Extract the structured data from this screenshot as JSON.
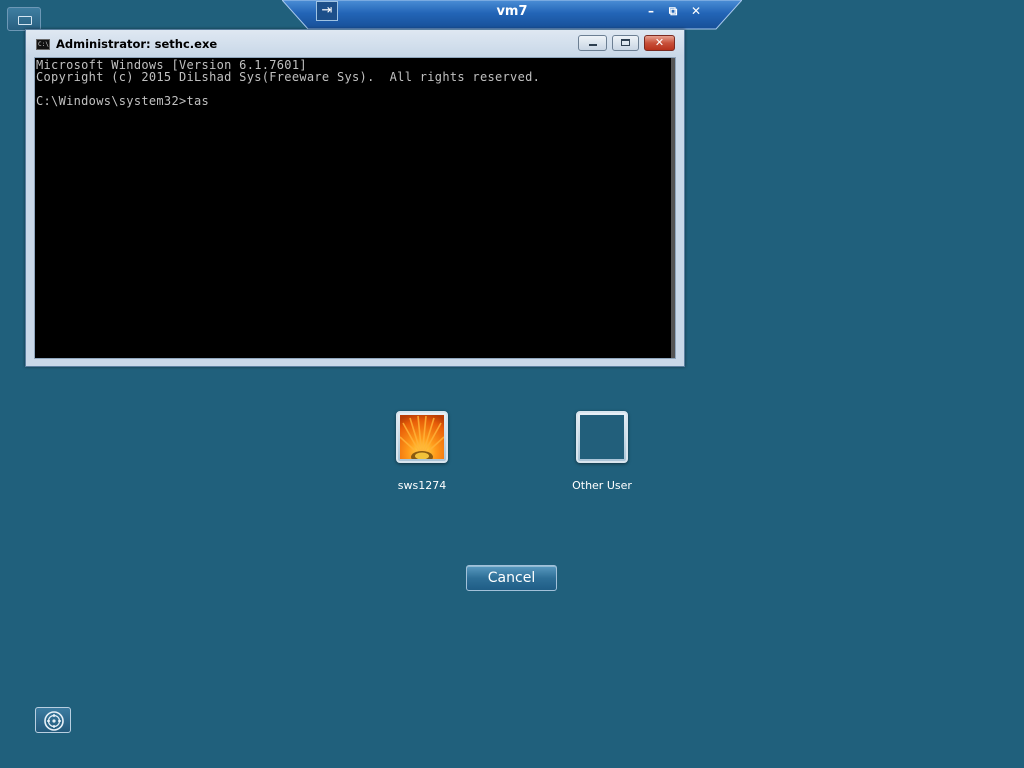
{
  "rdp_bar": {
    "title": "vm7",
    "pin_glyph": "⇥",
    "minimize_glyph": "–",
    "restore_glyph": "⧉",
    "close_glyph": "✕"
  },
  "cmd_window": {
    "title": "Administrator: sethc.exe",
    "icon_text": "C:\\",
    "close_glyph": "✕",
    "console_lines": [
      "Microsoft Windows [Version 6.1.7601]",
      "Copyright (c) 2015 DiLshad Sys(Freeware Sys).  All rights reserved.",
      "",
      "C:\\Windows\\system32>tas"
    ]
  },
  "users": [
    {
      "name": "sws1274",
      "icon": "flower-avatar-icon"
    },
    {
      "name": "Other User",
      "icon": "blank-avatar-icon"
    }
  ],
  "cancel_label": "Cancel",
  "icons": {
    "top_left": "keyboard-icon",
    "bottom_left": "ease-of-access-icon"
  },
  "colors": {
    "desktop_background": "#20607c",
    "console_background": "#000000",
    "console_text": "#c0c0c0"
  }
}
